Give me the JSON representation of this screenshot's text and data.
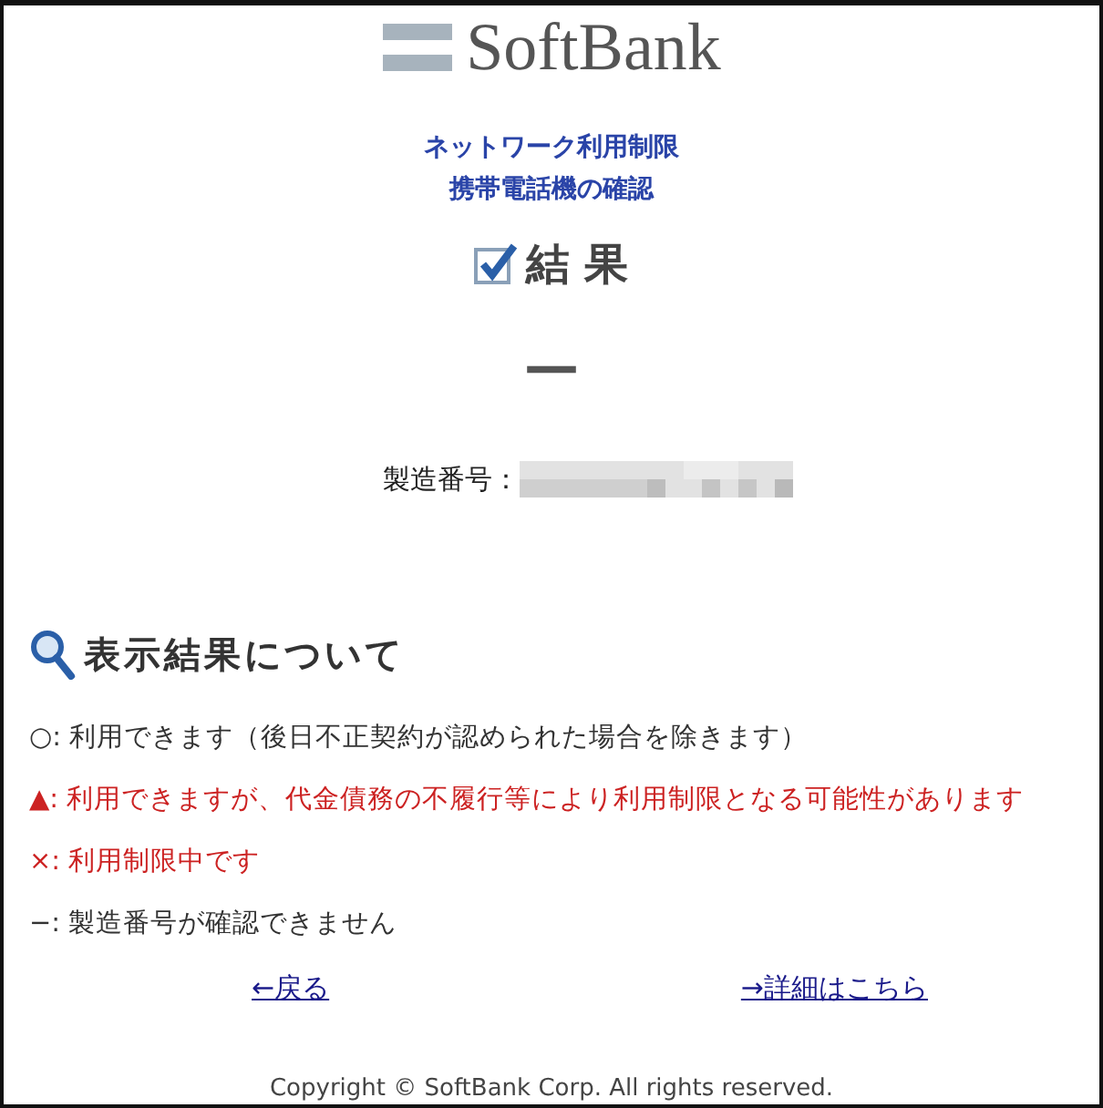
{
  "logo": {
    "text": "SoftBank"
  },
  "title_lines": [
    "ネットワーク利用制限",
    "携帯電話機の確認"
  ],
  "result": {
    "heading": "結 果",
    "value": "—"
  },
  "serial": {
    "label": "製造番号："
  },
  "legend": {
    "heading": "表示結果について",
    "items": [
      {
        "symbol": "○:",
        "text": "利用できます（後日不正契約が認められた場合を除きます）",
        "color": "#333333"
      },
      {
        "symbol": "▲:",
        "text": "利用できますが、代金債務の不履行等により利用制限となる可能性があります",
        "color": "#cc2222"
      },
      {
        "symbol": "×:",
        "text": "利用制限中です",
        "color": "#cc2222"
      },
      {
        "symbol": "−:",
        "text": "製造番号が確認できません",
        "color": "#333333"
      }
    ]
  },
  "links": [
    "←戻る",
    "→詳細はこちら"
  ],
  "footer": "Copyright © SoftBank Corp. All rights reserved."
}
